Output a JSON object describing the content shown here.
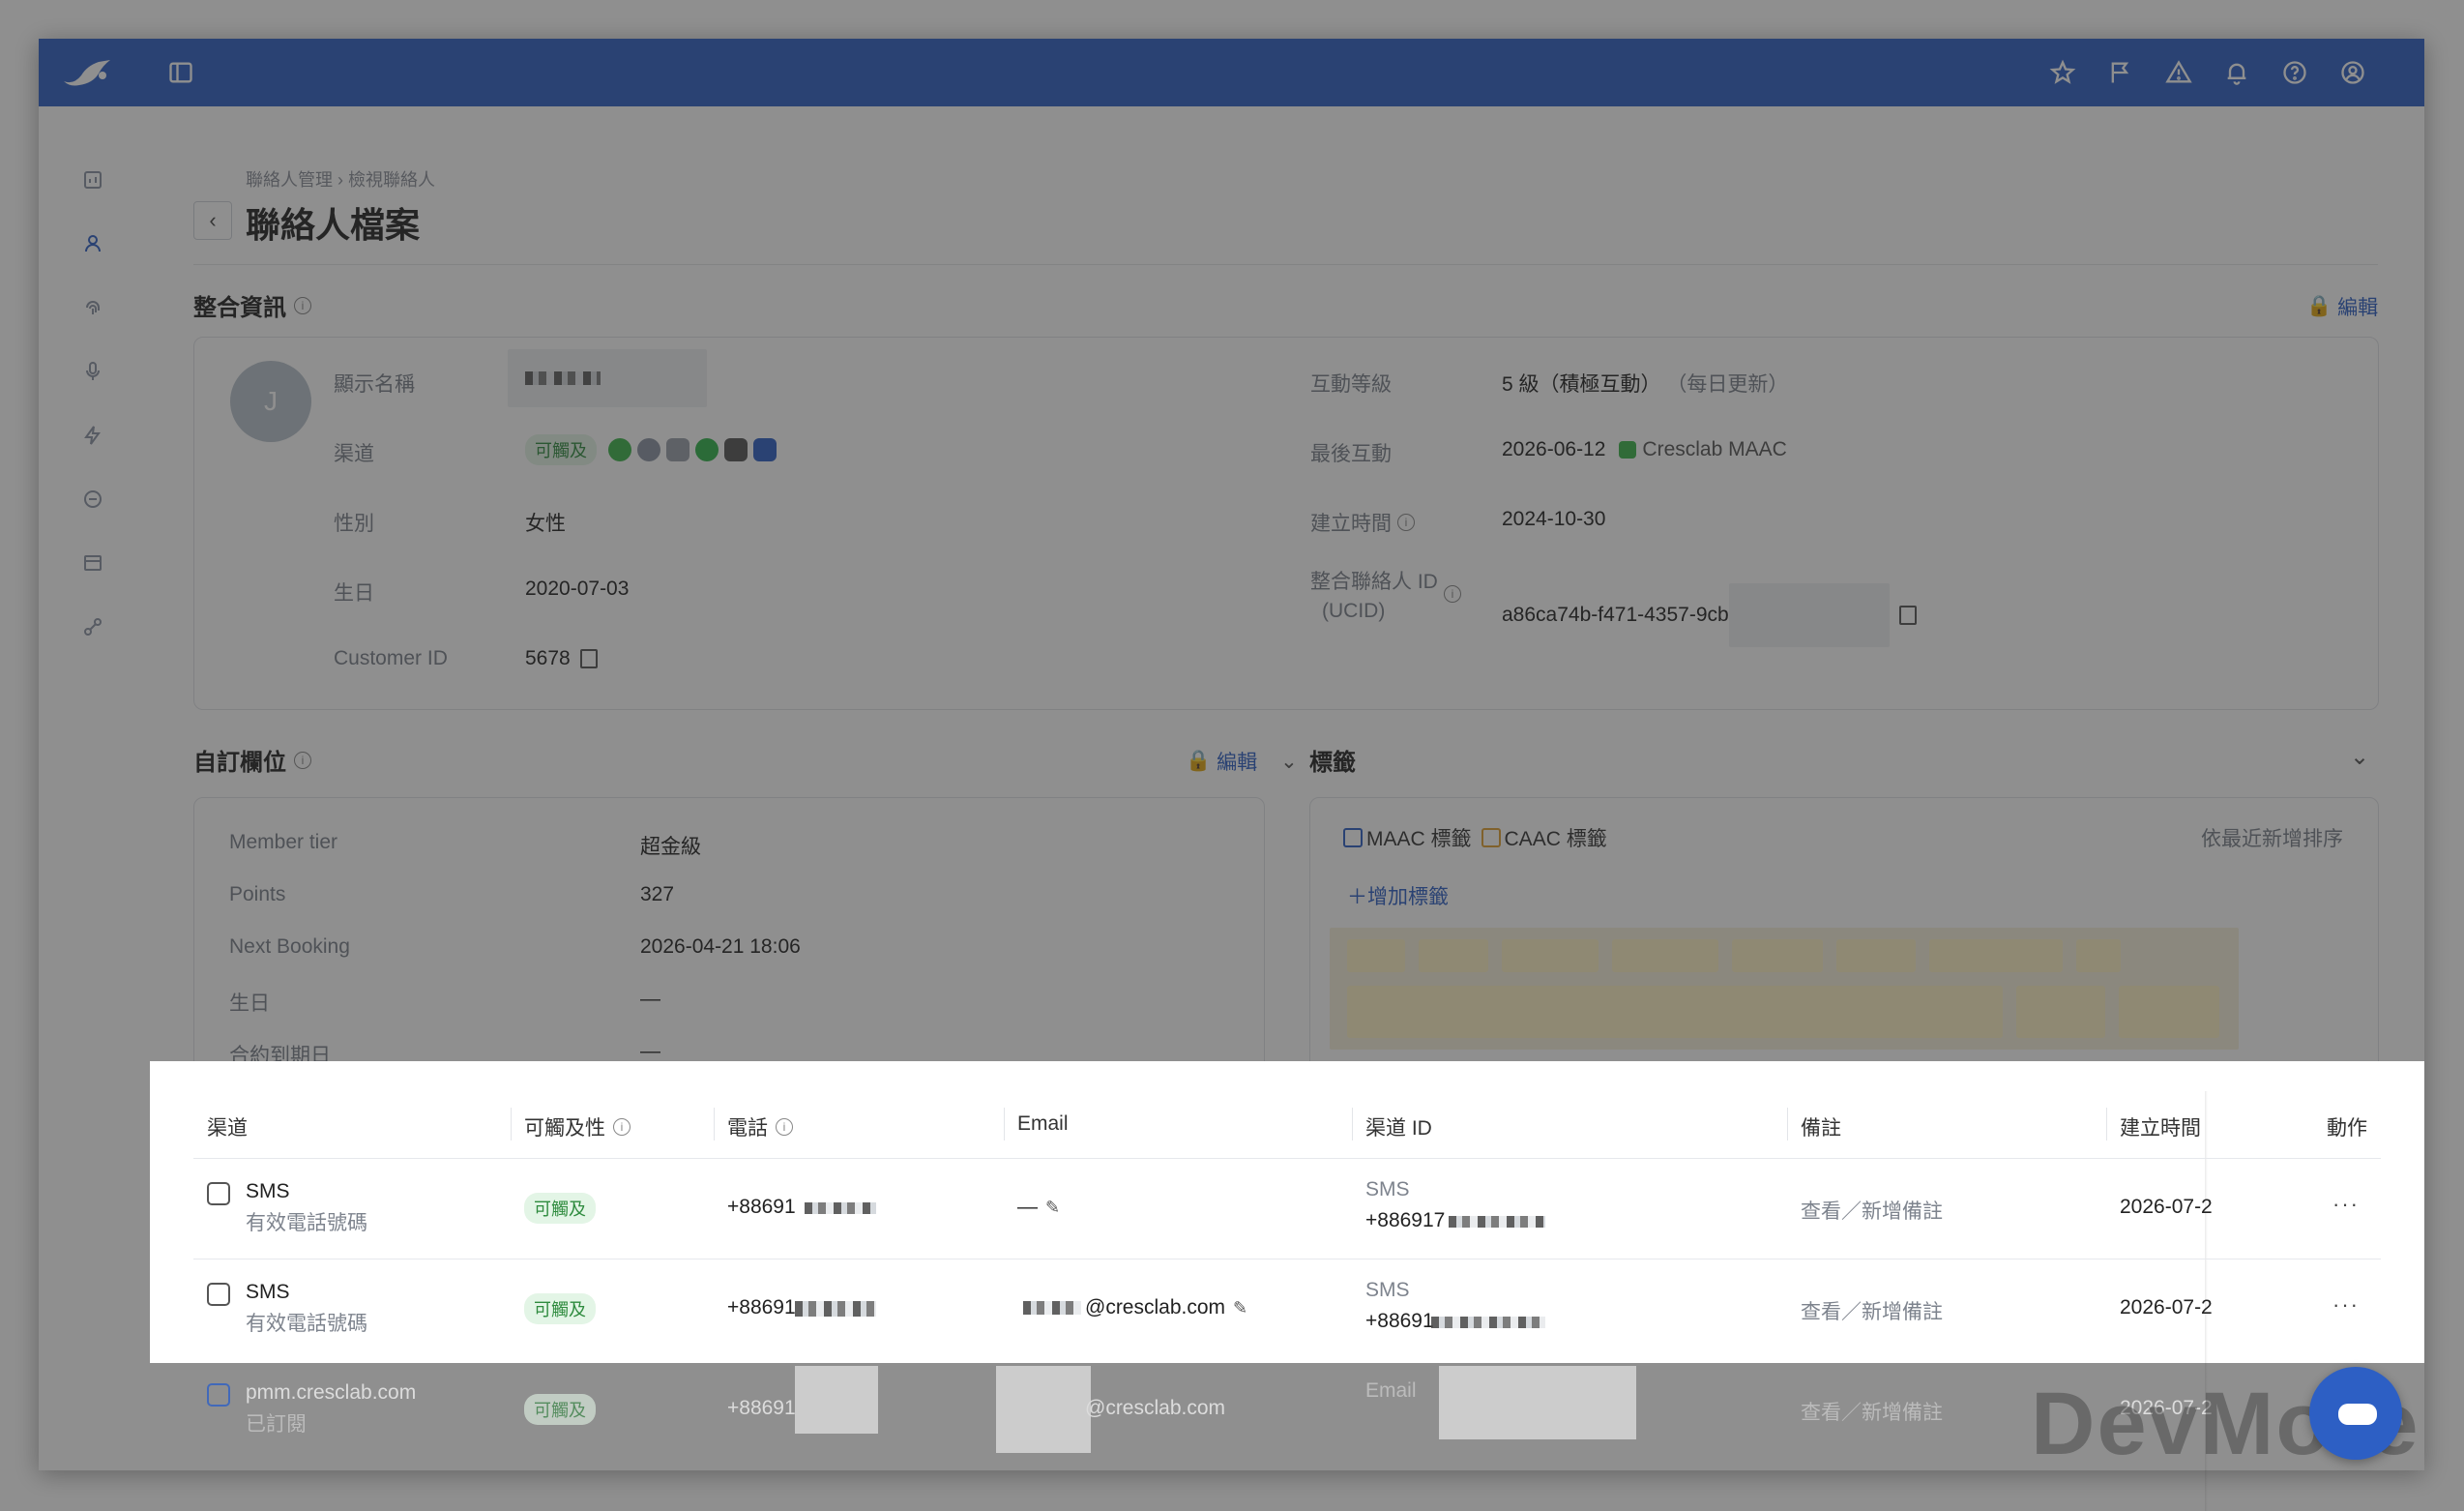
{
  "breadcrumb": {
    "part1": "聯絡人管理",
    "sep": "›",
    "part2": "檢視聯絡人"
  },
  "page_title": "聯絡人檔案",
  "integrated": {
    "title": "整合資訊",
    "edit_label": "編輯",
    "avatar_letter": "J",
    "display_name_label": "顯示名稱",
    "channel_label": "渠道",
    "reachable_badge": "可觸及",
    "gender_label": "性別",
    "gender_value": "女性",
    "birthday_label": "生日",
    "birthday_value": "2020-07-03",
    "customer_id_label": "Customer ID",
    "customer_id_value": "5678",
    "engagement_label": "互動等級",
    "engagement_value": "5 級（積極互動）",
    "engagement_note": "（每日更新）",
    "last_interaction_label": "最後互動",
    "last_interaction_date": "2026-06-12",
    "last_interaction_source": "Cresclab MAAC",
    "created_label": "建立時間",
    "created_value": "2024-10-30",
    "ucid_label_line1": "整合聯絡人 ID",
    "ucid_label_line2": "(UCID)",
    "ucid_value": "a86ca74b-f471-4357-9cb"
  },
  "custom_fields": {
    "title": "自訂欄位",
    "edit_label": "編輯",
    "rows": [
      {
        "label": "Member tier",
        "value": "超金級"
      },
      {
        "label": "Points",
        "value": "327"
      },
      {
        "label": "Next Booking",
        "value": "2026-04-21 18:06"
      },
      {
        "label": "生日",
        "value": "—"
      },
      {
        "label": "合約到期日",
        "value": "—"
      }
    ]
  },
  "tags": {
    "title": "標籤",
    "maac_label": "MAAC 標籤",
    "caac_label": "CAAC 標籤",
    "sort_label": "依最近新增排序",
    "add_label": "增加標籤"
  },
  "table": {
    "headers": {
      "channel": "渠道",
      "reachability": "可觸及性",
      "phone": "電話",
      "email": "Email",
      "channel_id": "渠道 ID",
      "note": "備註",
      "created": "建立時間",
      "action": "動作"
    },
    "rows": [
      {
        "channel": "SMS",
        "channel_sub": "有效電話號碼",
        "reach": "可觸及",
        "phone": "+88691",
        "email": "—",
        "cid_type": "SMS",
        "cid_value": "+886917",
        "note": "查看／新增備註",
        "created": "2026-07-2",
        "action": "···"
      },
      {
        "channel": "SMS",
        "channel_sub": "有效電話號碼",
        "reach": "可觸及",
        "phone": "+88691",
        "email": "@cresclab.com",
        "cid_type": "SMS",
        "cid_value": "+88691",
        "note": "查看／新增備註",
        "created": "2026-07-2",
        "action": "···"
      },
      {
        "channel": "pmm.cresclab.com",
        "channel_sub": "已訂閱",
        "reach": "可觸及",
        "phone": "+88691",
        "email": "@cresclab.com",
        "cid_type": "Email",
        "cid_value": "",
        "note": "查看／新增備註",
        "created": "2026-07-2",
        "action": ""
      }
    ]
  },
  "watermark": "DevMore",
  "colors": {
    "brand": "#2d5fc4",
    "reachable": "#2e8b3e"
  }
}
